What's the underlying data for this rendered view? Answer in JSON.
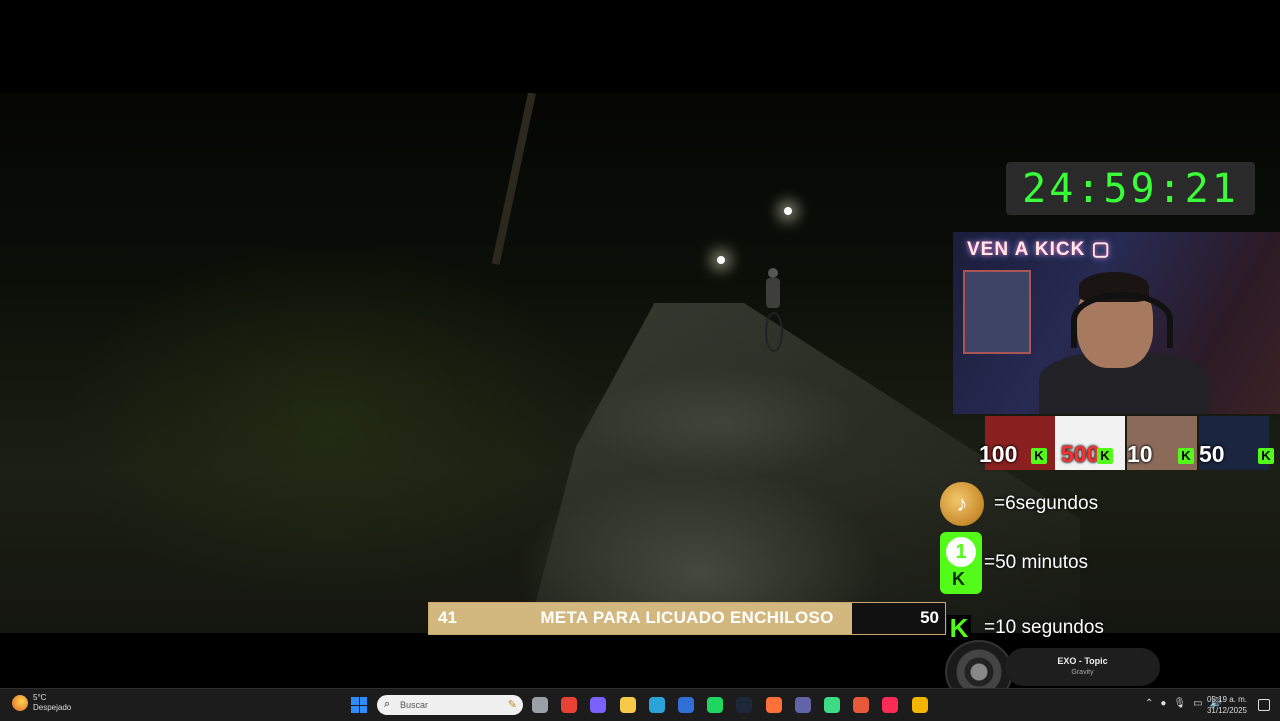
{
  "timer": {
    "value": "24:59:21"
  },
  "webcam": {
    "overlay_text": "VEN A KICK ▢"
  },
  "recent_donors": [
    {
      "amount": "100"
    },
    {
      "amount": "500"
    },
    {
      "amount": "10"
    },
    {
      "amount": "50"
    }
  ],
  "rates": {
    "tiktok_gift": "=6segundos",
    "kick_sub": "=50 minutos",
    "kick_kicks": "=10 segundos",
    "kick_sub_badge": "1",
    "kick_letter": "K"
  },
  "goal": {
    "start": "41",
    "title": "META PARA LICUADO ENCHILOSO",
    "target": "50",
    "progress_percent": 82
  },
  "now_playing": {
    "artist": "EXO - Topic",
    "track": "Gravity"
  },
  "taskbar": {
    "weather_temp": "5°C",
    "weather_desc": "Despejado",
    "search_placeholder": "Buscar",
    "time": "05:19 a. m.",
    "date": "31/12/2025",
    "apps": [
      {
        "name": "task-view-icon",
        "color": "#9aa0a6"
      },
      {
        "name": "chrome-icon",
        "color": "#e84235"
      },
      {
        "name": "copilot-icon",
        "color": "#7b61ff"
      },
      {
        "name": "file-explorer-icon",
        "color": "#f7c948"
      },
      {
        "name": "edge-icon",
        "color": "#2aa4d8"
      },
      {
        "name": "mail-icon",
        "color": "#2f6fd6"
      },
      {
        "name": "spotify-icon",
        "color": "#1ed760"
      },
      {
        "name": "steam-icon",
        "color": "#1b2838"
      },
      {
        "name": "firefox-icon",
        "color": "#ff7139"
      },
      {
        "name": "teams-icon",
        "color": "#6264a7"
      },
      {
        "name": "green-app-icon",
        "color": "#3ddc84"
      },
      {
        "name": "tf-icon",
        "color": "#e8593a"
      },
      {
        "name": "tiktok-icon",
        "color": "#fe2c55"
      },
      {
        "name": "chrome-icon",
        "color": "#f4b400"
      }
    ]
  },
  "colors": {
    "kick_green": "#53fc18",
    "timer_green": "#38ff38",
    "goal_fill": "#d2b87e"
  }
}
